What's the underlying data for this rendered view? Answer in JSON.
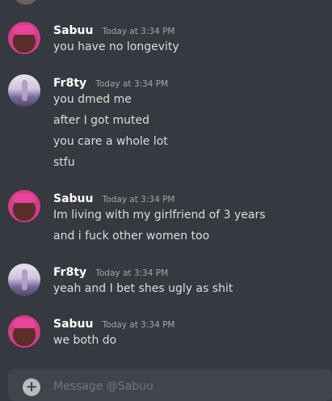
{
  "messages": [
    {
      "author": "Sabuu",
      "timestamp": "Today at 3:34 PM",
      "lines": [
        "you have no longevity"
      ]
    },
    {
      "author": "Fr8ty",
      "timestamp": "Today at 3:34 PM",
      "lines": [
        "you dmed me",
        "after I got muted",
        "you care a whole lot",
        "stfu"
      ]
    },
    {
      "author": "Sabuu",
      "timestamp": "Today at 3:34 PM",
      "lines": [
        "Im living with my girlfriend of 3 years",
        "and i fuck other women too"
      ]
    },
    {
      "author": "Fr8ty",
      "timestamp": "Today at 3:34 PM",
      "lines": [
        "yeah and I bet shes ugly as shit"
      ]
    },
    {
      "author": "Sabuu",
      "timestamp": "Today at 3:34 PM",
      "lines": [
        "we both do"
      ]
    }
  ],
  "composer": {
    "placeholder": "Message @Sabuu",
    "plus_icon": "plus-circle-icon"
  }
}
